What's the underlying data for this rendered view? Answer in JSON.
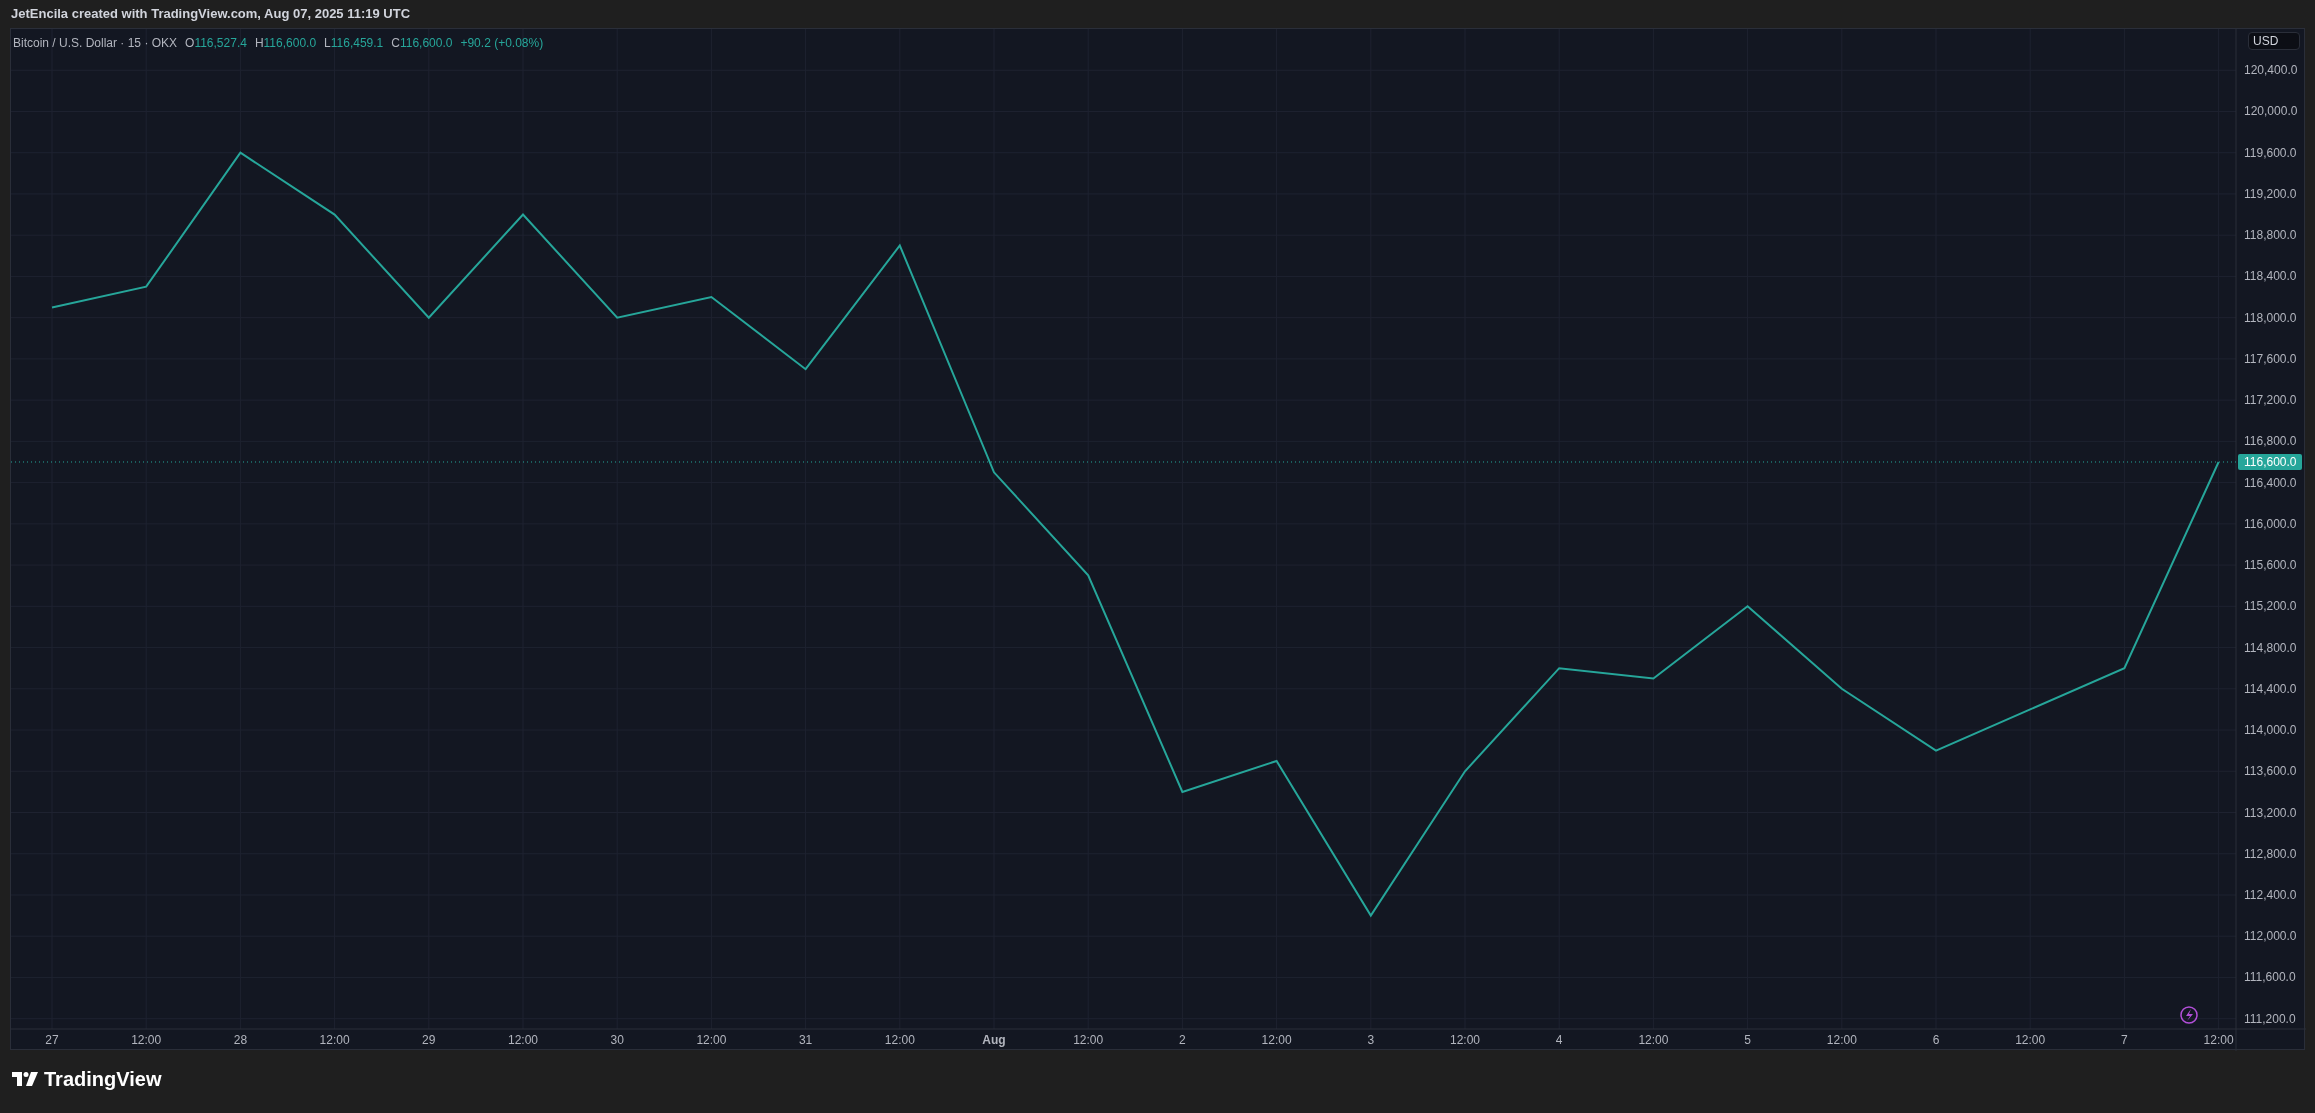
{
  "header": {
    "caption": "JetEncila created with TradingView.com, Aug 07, 2025 11:19 UTC"
  },
  "chart": {
    "legend": {
      "symbol": "Bitcoin / U.S. Dollar · 15 · OKX",
      "ohlc": [
        {
          "label": "O",
          "value": "116,527.4"
        },
        {
          "label": "H",
          "value": "116,600.0"
        },
        {
          "label": "L",
          "value": "116,459.1"
        },
        {
          "label": "C",
          "value": "116,600.0"
        }
      ],
      "change": "+90.2 (+0.08%)"
    },
    "currency": "USD",
    "chart_data": {
      "type": "line",
      "grid": true,
      "ref_lines": [
        {
          "axis": "y",
          "value": 116600,
          "label": "116,600.0",
          "color": "#26a69a"
        }
      ],
      "x": [
        "27",
        "12:00",
        "28",
        "12:00",
        "29",
        "12:00",
        "30",
        "12:00",
        "31",
        "12:00",
        "Aug",
        "12:00",
        "2",
        "12:00",
        "3",
        "12:00",
        "4",
        "12:00",
        "5",
        "12:00",
        "6",
        "12:00",
        "7",
        "12:00"
      ],
      "series": [
        {
          "color": "#26a69a",
          "values": [
            118100,
            118300,
            119600,
            119000,
            118000,
            119000,
            118000,
            118200,
            117500,
            118700,
            116500,
            115500,
            113400,
            113700,
            112200,
            113600,
            114600,
            114500,
            115200,
            114400,
            113800,
            114200,
            114600,
            116600
          ]
        }
      ],
      "ylim": [
        111100,
        120800
      ],
      "yticks": [
        {
          "value": 120400,
          "label": "120,400.0"
        },
        {
          "value": 120000,
          "label": "120,000.0"
        },
        {
          "value": 119600,
          "label": "119,600.0"
        },
        {
          "value": 119200,
          "label": "119,200.0"
        },
        {
          "value": 118800,
          "label": "118,800.0"
        },
        {
          "value": 118400,
          "label": "118,400.0"
        },
        {
          "value": 118000,
          "label": "118,000.0"
        },
        {
          "value": 117600,
          "label": "117,600.0"
        },
        {
          "value": 117200,
          "label": "117,200.0"
        },
        {
          "value": 116800,
          "label": "116,800.0"
        },
        {
          "value": 116400,
          "label": "116,400.0"
        },
        {
          "value": 116000,
          "label": "116,000.0"
        },
        {
          "value": 115600,
          "label": "115,600.0"
        },
        {
          "value": 115200,
          "label": "115,200.0"
        },
        {
          "value": 114800,
          "label": "114,800.0"
        },
        {
          "value": 114400,
          "label": "114,400.0"
        },
        {
          "value": 114000,
          "label": "114,000.0"
        },
        {
          "value": 113600,
          "label": "113,600.0"
        },
        {
          "value": 113200,
          "label": "113,200.0"
        },
        {
          "value": 112800,
          "label": "112,800.0"
        },
        {
          "value": 112400,
          "label": "112,400.0"
        },
        {
          "value": 112000,
          "label": "112,000.0"
        },
        {
          "value": 111600,
          "label": "111,600.0"
        },
        {
          "value": 111200,
          "label": "111,200.0"
        }
      ]
    }
  },
  "footer": {
    "brand": "TradingView"
  }
}
